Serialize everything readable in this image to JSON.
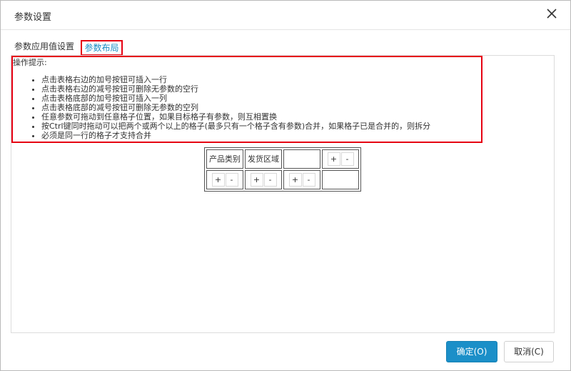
{
  "dialog": {
    "title": "参数设置"
  },
  "tabs": [
    {
      "label": "参数应用值设置",
      "active": false
    },
    {
      "label": "参数布局",
      "active": true
    }
  ],
  "tips": {
    "title": "操作提示:",
    "items": [
      "点击表格右边的加号按钮可插入一行",
      "点击表格右边的减号按钮可删除无参数的空行",
      "点击表格底部的加号按钮可插入一列",
      "点击表格底部的减号按钮可删除无参数的空列",
      "任意参数可拖动到任意格子位置，如果目标格子有参数，则互相置换",
      "按Ctrl键同时拖动可以把两个或两个以上的格子(最多只有一个格子含有参数)合并，如果格子已是合并的，则拆分",
      "必须是同一行的格子才支持合并"
    ]
  },
  "grid": {
    "row1": {
      "cell1": "产品类别",
      "cell2": "发货区域",
      "cell3": ""
    },
    "plus": "+",
    "minus": "-"
  },
  "buttons": {
    "ok": "确定(O)",
    "cancel": "取消(C)"
  },
  "colors": {
    "accent": "#1b8fc8",
    "highlight_border": "#e60012",
    "active_tab_text": "#1a8cc4"
  }
}
